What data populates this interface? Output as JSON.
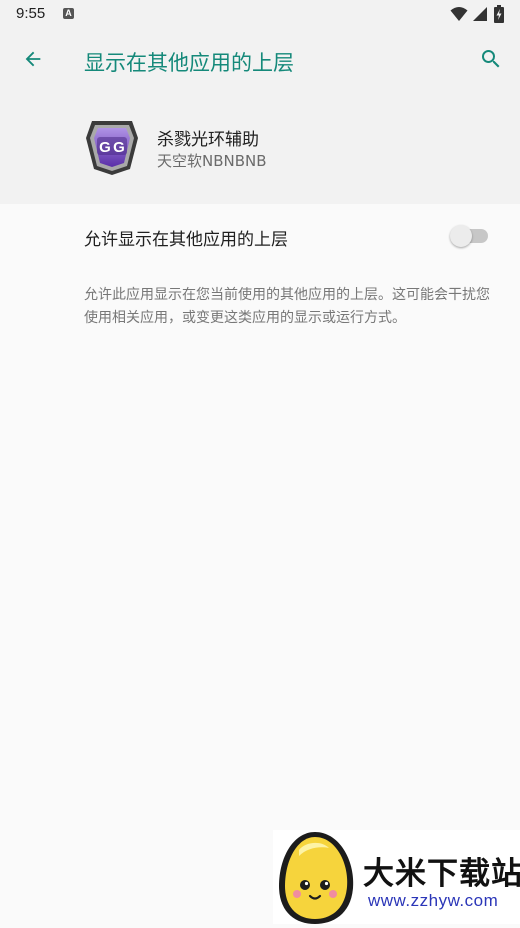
{
  "status_bar": {
    "time": "9:55",
    "notification_icon": "A"
  },
  "app_bar": {
    "title": "显示在其他应用的上层",
    "back_icon": "arrow-left-icon",
    "search_icon": "search-icon"
  },
  "app": {
    "name": "杀戮光环辅助",
    "developer": "天空软NBNBNB",
    "icon_letters": "GG"
  },
  "permission": {
    "label": "允许显示在其他应用的上层",
    "enabled": false,
    "description": "允许此应用显示在您当前使用的其他应用的上层。这可能会干扰您使用相关应用，或变更这类应用的显示或运行方式。"
  },
  "watermark": {
    "title": "大米下载站",
    "url": "www.zzhyw.com"
  },
  "colors": {
    "accent": "#15897a",
    "background": "#fafafa",
    "header_background": "#f2f2f2",
    "watermark_url": "#2b36b8"
  }
}
